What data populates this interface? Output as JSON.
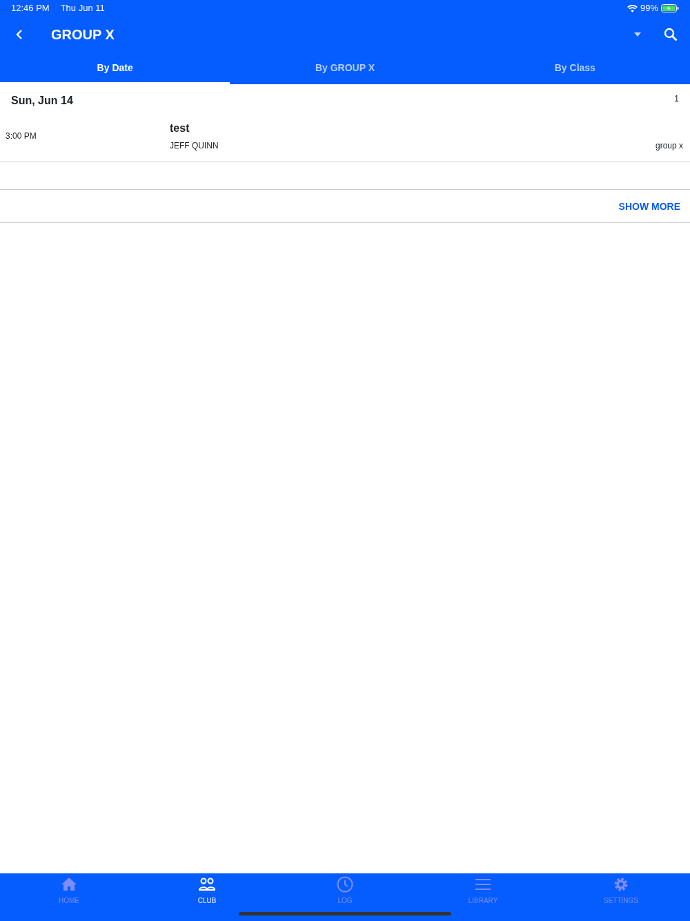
{
  "status_bar": {
    "time": "12:46 PM",
    "date": "Thu Jun 11",
    "battery": "99%"
  },
  "header": {
    "title": "GROUP X"
  },
  "tabs": [
    {
      "label": "By Date",
      "selected": true
    },
    {
      "label": "By GROUP X",
      "selected": false
    },
    {
      "label": "By Class",
      "selected": false
    }
  ],
  "sections": [
    {
      "date": "Sun, Jun 14",
      "count": "1",
      "events": [
        {
          "time": "3:00 PM",
          "title": "test",
          "instructor": "JEFF QUINN",
          "category": "group x"
        }
      ]
    }
  ],
  "show_more": "SHOW MORE",
  "bottom_nav": [
    {
      "kind": "home",
      "label": "HOME",
      "selected": false
    },
    {
      "kind": "club",
      "label": "CLUB",
      "selected": true
    },
    {
      "kind": "log",
      "label": "LOG",
      "selected": false
    },
    {
      "kind": "library",
      "label": "LIBRARY",
      "selected": false
    },
    {
      "kind": "settings",
      "label": "SETTINGS",
      "selected": false
    }
  ]
}
